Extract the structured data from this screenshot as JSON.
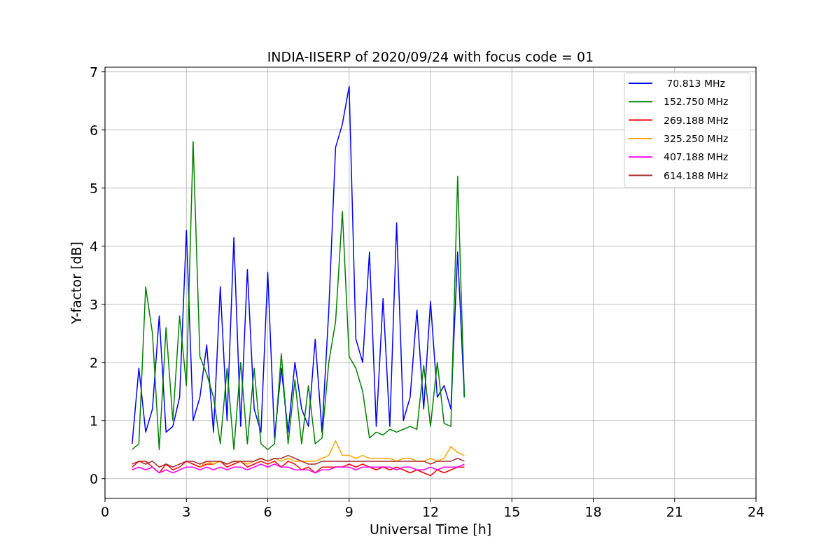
{
  "chart_data": {
    "type": "line",
    "title": "INDIA-IISERP of 2020/09/24 with focus code = 01",
    "xlabel": "Universal Time [h]",
    "ylabel": "Y-factor [dB]",
    "x": [
      1.0,
      1.25,
      1.5,
      1.75,
      2.0,
      2.25,
      2.5,
      2.75,
      3.0,
      3.25,
      3.5,
      3.75,
      4.0,
      4.25,
      4.5,
      4.75,
      5.0,
      5.25,
      5.5,
      5.75,
      6.0,
      6.25,
      6.5,
      6.75,
      7.0,
      7.25,
      7.5,
      7.75,
      8.0,
      8.25,
      8.5,
      8.75,
      9.0,
      9.25,
      9.5,
      9.75,
      10.0,
      10.25,
      10.5,
      10.75,
      11.0,
      11.25,
      11.5,
      11.75,
      12.0,
      12.25,
      12.5,
      12.75,
      13.0,
      13.25
    ],
    "series": [
      {
        "name": " 70.813 MHz",
        "color": "#0000ff",
        "values": [
          0.6,
          1.9,
          0.8,
          1.2,
          2.8,
          0.8,
          0.9,
          1.4,
          4.27,
          1.0,
          1.4,
          2.3,
          0.8,
          3.3,
          1.0,
          4.15,
          0.9,
          3.6,
          1.2,
          0.8,
          3.55,
          0.7,
          1.9,
          0.8,
          2.0,
          1.2,
          0.9,
          2.4,
          0.8,
          2.9,
          5.7,
          6.1,
          6.75,
          2.4,
          2.0,
          3.9,
          0.9,
          3.1,
          0.9,
          4.4,
          1.0,
          1.4,
          2.9,
          1.2,
          3.05,
          1.4,
          1.6,
          1.2,
          3.9,
          1.4
        ]
      },
      {
        "name": "152.750 MHz",
        "color": "#008000",
        "values": [
          0.5,
          0.6,
          3.3,
          2.5,
          0.5,
          2.6,
          1.0,
          2.8,
          1.6,
          5.8,
          2.1,
          1.8,
          1.4,
          0.6,
          1.9,
          0.5,
          2.0,
          0.6,
          1.9,
          0.6,
          0.5,
          0.6,
          2.15,
          0.6,
          1.7,
          0.6,
          1.6,
          0.6,
          0.7,
          2.0,
          2.7,
          4.6,
          2.1,
          1.9,
          1.5,
          0.7,
          0.8,
          0.75,
          0.85,
          0.8,
          0.85,
          0.9,
          0.85,
          1.95,
          0.9,
          2.0,
          0.95,
          0.9,
          5.2,
          1.4
        ]
      },
      {
        "name": "269.188 MHz",
        "color": "#ff0000",
        "values": [
          0.2,
          0.3,
          0.3,
          0.2,
          0.1,
          0.25,
          0.15,
          0.2,
          0.3,
          0.25,
          0.2,
          0.25,
          0.25,
          0.3,
          0.2,
          0.25,
          0.3,
          0.2,
          0.25,
          0.3,
          0.25,
          0.3,
          0.2,
          0.3,
          0.25,
          0.15,
          0.2,
          0.1,
          0.2,
          0.2,
          0.2,
          0.2,
          0.25,
          0.2,
          0.25,
          0.2,
          0.15,
          0.2,
          0.15,
          0.2,
          0.15,
          0.1,
          0.15,
          0.1,
          0.05,
          0.15,
          0.1,
          0.15,
          0.2,
          0.2
        ]
      },
      {
        "name": "325.250 MHz",
        "color": "#ffa500",
        "values": [
          null,
          null,
          null,
          null,
          null,
          null,
          null,
          null,
          null,
          null,
          0.2,
          0.3,
          0.25,
          0.3,
          0.25,
          0.3,
          0.3,
          0.25,
          0.3,
          0.35,
          0.3,
          0.35,
          0.3,
          0.35,
          0.3,
          0.3,
          0.3,
          0.3,
          0.35,
          0.4,
          0.65,
          0.4,
          0.4,
          0.35,
          0.4,
          0.35,
          0.35,
          0.35,
          0.35,
          0.3,
          0.35,
          0.35,
          0.3,
          0.3,
          0.35,
          0.3,
          0.35,
          0.55,
          0.45,
          0.4
        ]
      },
      {
        "name": "407.188 MHz",
        "color": "#ff00ff",
        "values": [
          0.15,
          0.2,
          0.15,
          0.2,
          0.1,
          0.15,
          0.1,
          0.15,
          0.2,
          0.2,
          0.15,
          0.2,
          0.15,
          0.2,
          0.15,
          0.2,
          0.2,
          0.15,
          0.2,
          0.25,
          0.2,
          0.25,
          0.2,
          0.2,
          0.15,
          0.15,
          0.15,
          0.1,
          0.15,
          0.15,
          0.2,
          0.2,
          0.2,
          0.15,
          0.2,
          0.2,
          0.2,
          0.2,
          0.2,
          0.15,
          0.2,
          0.2,
          0.15,
          0.15,
          0.2,
          0.15,
          0.2,
          0.2,
          0.2,
          0.25
        ]
      },
      {
        "name": "614.188 MHz",
        "color": "#a52a2a",
        "values": [
          0.25,
          0.3,
          0.25,
          0.3,
          0.2,
          0.25,
          0.2,
          0.25,
          0.3,
          0.3,
          0.25,
          0.3,
          0.3,
          0.3,
          0.25,
          0.3,
          0.3,
          0.3,
          0.3,
          0.35,
          0.3,
          0.35,
          0.35,
          0.4,
          0.35,
          0.3,
          0.25,
          0.25,
          0.3,
          0.3,
          0.3,
          0.3,
          0.3,
          0.3,
          0.3,
          0.3,
          0.3,
          0.3,
          0.3,
          0.3,
          0.3,
          0.3,
          0.3,
          0.3,
          0.25,
          0.3,
          0.3,
          0.3,
          0.35,
          0.3
        ]
      }
    ],
    "xlim": [
      0,
      24
    ],
    "ylim": [
      -0.34,
      7.08
    ],
    "xticks": [
      0,
      3,
      6,
      9,
      12,
      15,
      18,
      21,
      24
    ],
    "yticks": [
      0,
      1,
      2,
      3,
      4,
      5,
      6,
      7
    ],
    "grid": true,
    "legend": true
  }
}
